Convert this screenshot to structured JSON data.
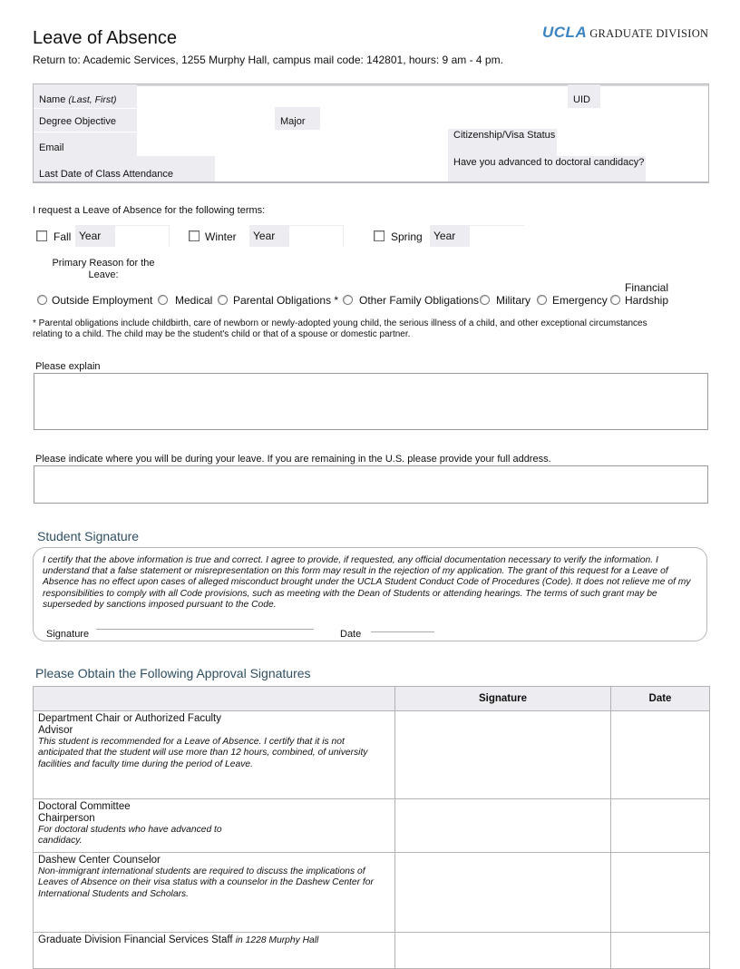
{
  "header": {
    "title": "Leave of Absence",
    "return_to": "Return to: Academic Services, 1255 Murphy Hall, campus mail code: 142801, hours: 9 am - 4 pm.",
    "logo_ucla": "UCLA",
    "logo_division": "GRADUATE DIVISION",
    "brand_color": "#3a84c1"
  },
  "info": {
    "name_label": "Name",
    "name_hint": "(Last, First)",
    "uid_label": "UID",
    "degree_label": "Degree Objective",
    "major_label": "Major",
    "email_label": "Email",
    "citizenship_label": "Citizenship/Visa Status",
    "last_date_label": "Last Date of Class Attendance",
    "candidacy_label": "Have you advanced to doctoral candidacy?",
    "name_value": "",
    "uid_value": "",
    "degree_value": "",
    "major_value": "",
    "email_value": "",
    "citizenship_value": "",
    "last_date_value": "",
    "candidacy_value": ""
  },
  "terms": {
    "intro": "I request a Leave of Absence for the following terms:",
    "items": [
      {
        "label": "Fall",
        "year_label": "Year",
        "checked": false,
        "year_value": ""
      },
      {
        "label": "Winter",
        "year_label": "Year",
        "checked": false,
        "year_value": ""
      },
      {
        "label": "Spring",
        "year_label": "Year",
        "checked": false,
        "year_value": ""
      }
    ]
  },
  "reason": {
    "label": "Primary Reason for the Leave:",
    "options": [
      {
        "label": "Outside Employment",
        "selected": false
      },
      {
        "label": "Medical",
        "selected": false
      },
      {
        "label": "Parental Obligations *",
        "selected": false
      },
      {
        "label": "Other Family Obligations",
        "selected": false
      },
      {
        "label": "Military",
        "selected": false
      },
      {
        "label": "Emergency",
        "selected": false
      },
      {
        "label": "Financial Hardship",
        "selected": false
      }
    ],
    "footnote": "* Parental obligations include childbirth, care of newborn or newly-adopted young child, the serious illness of a child, and other exceptional circumstances relating to a child. The child may be the student's child or that of a spouse or domestic partner."
  },
  "explain": {
    "label": "Please explain",
    "value": ""
  },
  "location": {
    "label": "Please indicate where you will be during your leave. If you are remaining in the U.S. please provide your full address.",
    "value": ""
  },
  "student_signature": {
    "heading": "Student Signature",
    "certify_text": "I certify that the above information is true and correct. I agree to provide, if requested, any official documentation necessary to verify the information. I understand that a false statement or misrepresentation on this form may result in the rejection of my application. The grant of this request for a Leave of Absence has no effect upon cases of alleged misconduct brought under the UCLA Student Conduct Code of Procedures (Code). It does not relieve me of my responsibilities to comply with all Code provisions, such as meeting with the Dean of Students or attending hearings. The terms of such grant may be superseded by sanctions imposed pursuant to the Code.",
    "signature_label": "Signature",
    "date_label": "Date"
  },
  "approvals": {
    "heading": "Please Obtain the Following Approval Signatures",
    "columns": [
      "",
      "Signature",
      "Date"
    ],
    "rows": [
      {
        "role": "Department Chair or Authorized Faculty Advisor",
        "note": "This student is recommended for a Leave of Absence. I certify that it is not anticipated that the student will use more than 12 hours, combined, of university facilities and faculty time during the period of Leave.",
        "role_suffix": ""
      },
      {
        "role": "Doctoral Committee Chairperson",
        "note": "For doctoral students who have advanced to candidacy.",
        "role_suffix": ""
      },
      {
        "role": "Dashew Center Counselor",
        "note": "Non-immigrant international students are required to discuss the implications of Leaves of Absence on their visa status with a counselor in the Dashew Center for International Students and Scholars.",
        "role_suffix": ""
      },
      {
        "role": "Graduate Division Financial Services Staff",
        "note": "",
        "role_suffix": "in 1228 Murphy Hall"
      }
    ]
  }
}
